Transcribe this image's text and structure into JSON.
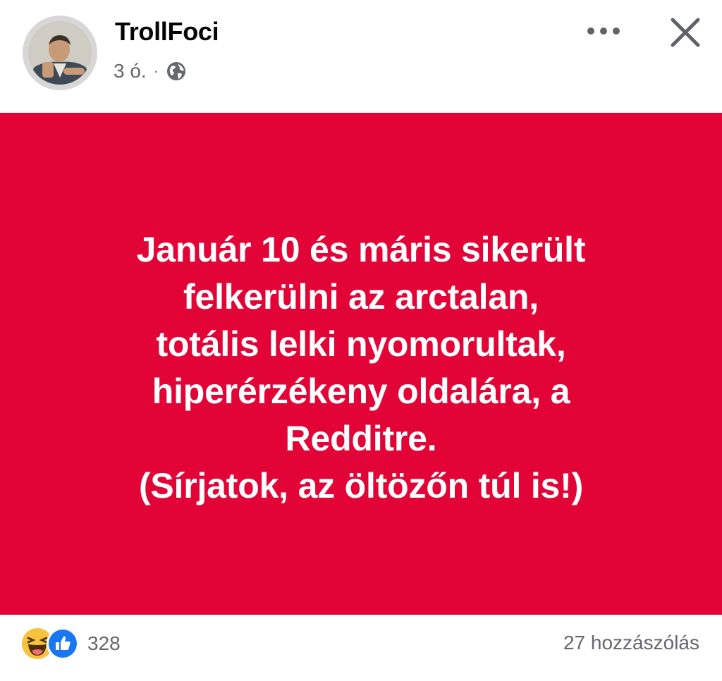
{
  "header": {
    "author": "TrollFoci",
    "time": "3 ó.",
    "separator": "·",
    "privacy_icon": "globe-icon",
    "more_icon": "more-horizontal-icon",
    "close_icon": "close-icon"
  },
  "post": {
    "background_color": "#e20437",
    "text_color": "#ffffff",
    "lines": [
      "Január 10 és máris sikerült",
      "felkerülni az arctalan,",
      "totális lelki nyomorultak,",
      "hiperérzékeny oldalára, a",
      "Redditre.",
      "(Sírjatok, az öltözőn túl is!)"
    ]
  },
  "footer": {
    "reaction_icons": [
      "haha-reaction-icon",
      "like-reaction-icon"
    ],
    "reaction_count": "328",
    "comments": "27 hozzászólás"
  },
  "colors": {
    "muted_text": "#65676b",
    "like_blue": "#1877f2",
    "haha_yellow": "#f7c33c"
  }
}
